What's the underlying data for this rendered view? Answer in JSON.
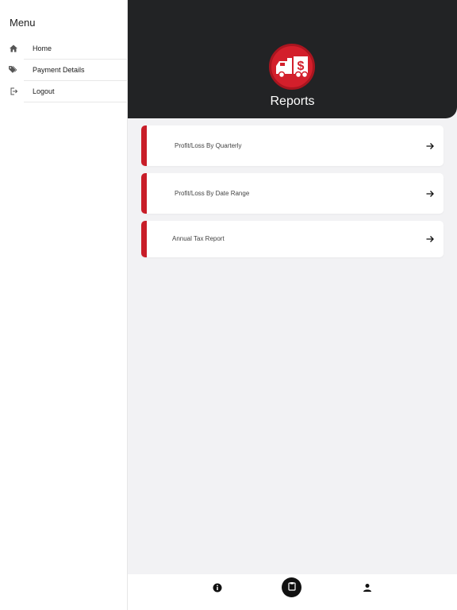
{
  "sidebar": {
    "title": "Menu",
    "items": [
      {
        "label": "Home",
        "icon": "home-icon"
      },
      {
        "label": "Payment Details",
        "icon": "tags-icon"
      },
      {
        "label": "Logout",
        "icon": "logout-icon"
      }
    ]
  },
  "header": {
    "title": "Reports",
    "logo_icon": "truck-dollar-icon"
  },
  "reports": [
    {
      "label": "Profit/Loss By Quarterly",
      "icon": "arrow-right-icon"
    },
    {
      "label": "Profit/Loss By Date Range",
      "icon": "arrow-right-icon"
    },
    {
      "label": "Annual Tax Report",
      "icon": "arrow-right-icon"
    }
  ],
  "tabbar": {
    "tabs": [
      {
        "icon": "info-icon",
        "active": false
      },
      {
        "icon": "clipboard-icon",
        "active": true
      },
      {
        "icon": "user-icon",
        "active": false
      }
    ]
  },
  "colors": {
    "accent": "#c81d28",
    "header_bg": "#222325",
    "content_bg": "#f2f2f4"
  }
}
